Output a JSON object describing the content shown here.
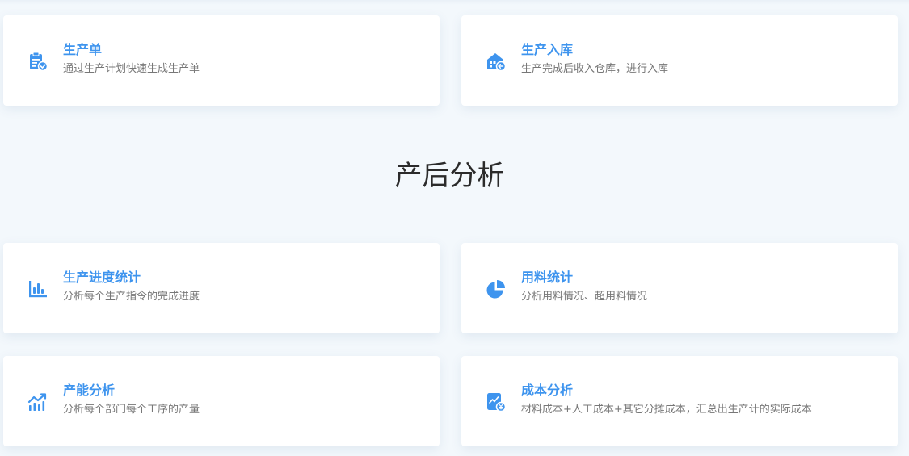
{
  "colors": {
    "background": "#f3f8fc",
    "card": "#ffffff",
    "accent": "#3e94ee",
    "description": "#777777",
    "heading": "#2b2b2b"
  },
  "top_cards": [
    {
      "icon": "clipboard-check-icon",
      "title": "生产单",
      "desc": "通过生产计划快速生成生产单"
    },
    {
      "icon": "warehouse-in-icon",
      "title": "生产入库",
      "desc": "生产完成后收入仓库，进行入库"
    }
  ],
  "section": {
    "title": "产后分析"
  },
  "analysis_cards": [
    {
      "icon": "bar-chart-icon",
      "title": "生产进度统计",
      "desc": "分析每个生产指令的完成进度"
    },
    {
      "icon": "pie-chart-icon",
      "title": "用料统计",
      "desc": "分析用料情况、超用料情况"
    },
    {
      "icon": "trend-chart-icon",
      "title": "产能分析",
      "desc": "分析每个部门每个工序的产量"
    },
    {
      "icon": "cost-report-icon",
      "title": "成本分析",
      "desc": "材料成本+人工成本+其它分摊成本，汇总出生产计的实际成本"
    }
  ]
}
